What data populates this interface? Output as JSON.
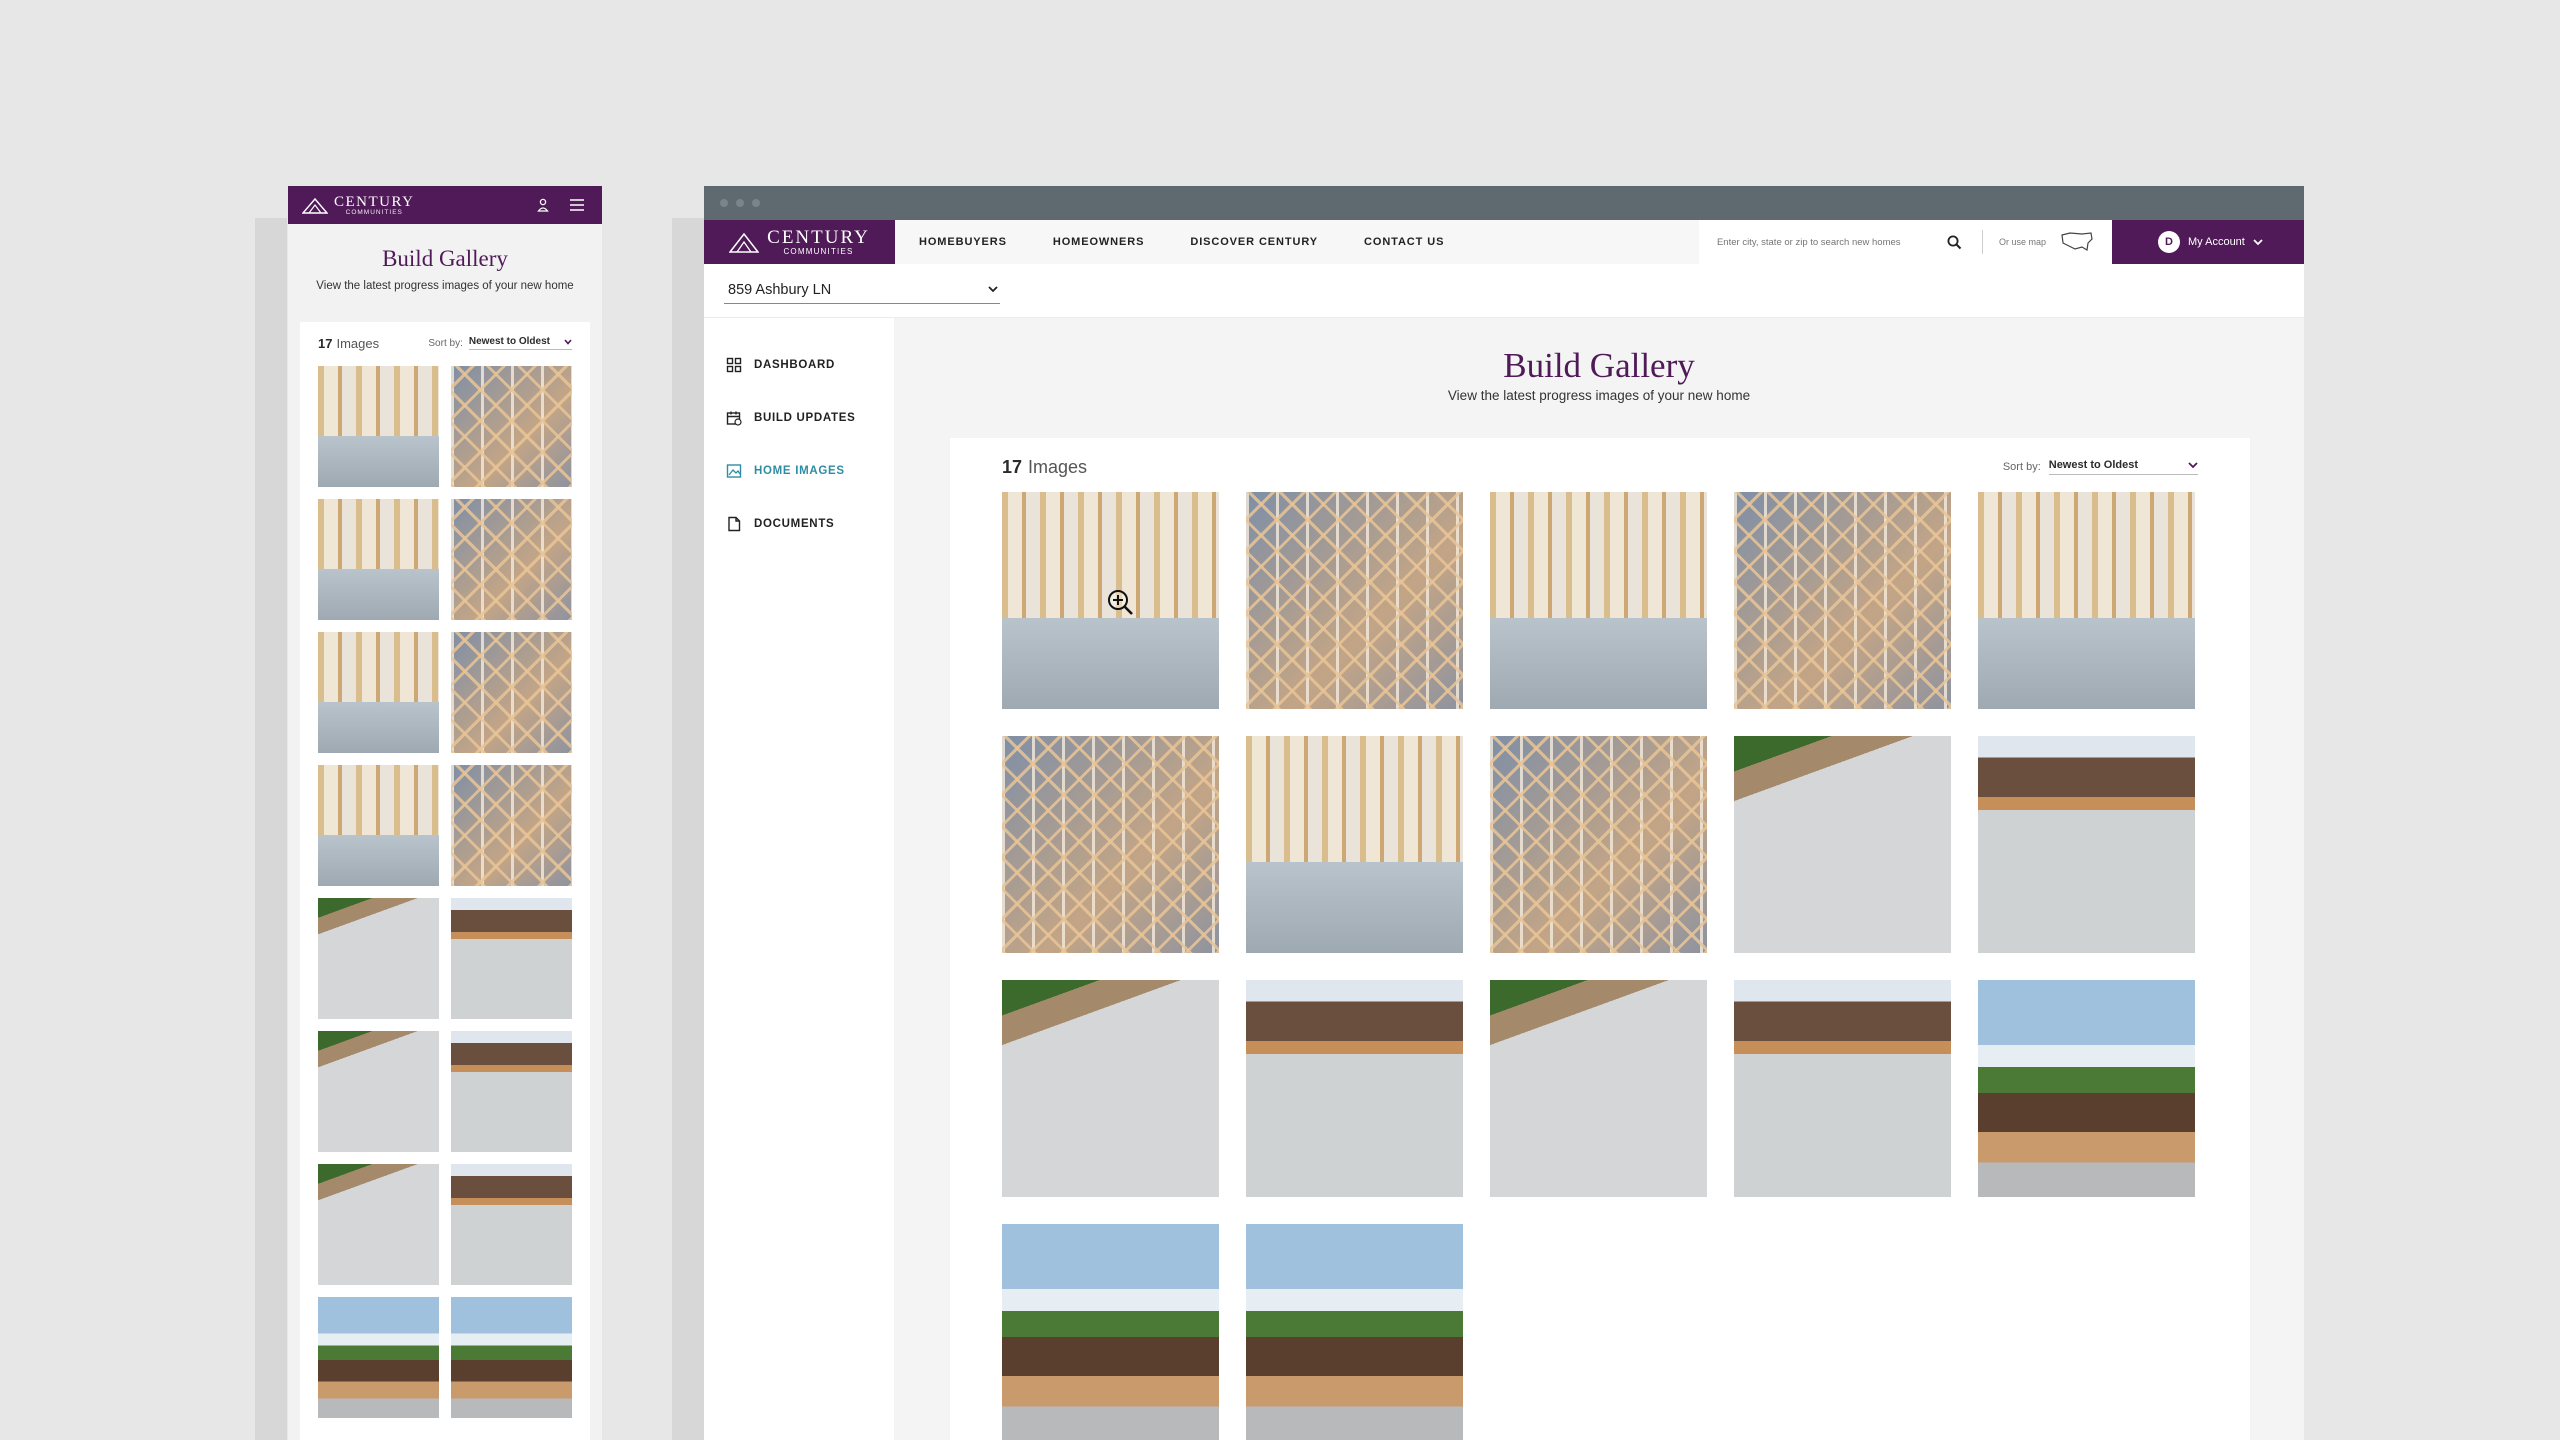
{
  "brand": {
    "name": "CENTURY",
    "tagline": "COMMUNITIES",
    "color": "#4f1a57",
    "accent": "#2f8da3"
  },
  "mobile": {
    "title": "Build Gallery",
    "subtitle": "View the latest progress images of your new home",
    "count": "17",
    "count_label": "Images",
    "sort_label": "Sort by:",
    "sort_value": "Newest to Oldest",
    "thumbs": [
      "framing",
      "truss",
      "framing",
      "truss",
      "framing",
      "truss",
      "framing",
      "truss",
      "slab",
      "house",
      "slab",
      "house",
      "slab",
      "house",
      "field",
      "field"
    ]
  },
  "desktop": {
    "nav": {
      "links": [
        "HOMEBUYERS",
        "HOMEOWNERS",
        "DISCOVER CENTURY",
        "CONTACT US"
      ],
      "search_placeholder": "Enter city, state or zip to search new homes",
      "map_label": "Or use map",
      "account_initial": "D",
      "account_label": "My Account"
    },
    "address": "859 Ashbury LN",
    "sidebar": [
      {
        "label": "DASHBOARD",
        "icon": "dashboard-icon",
        "active": false
      },
      {
        "label": "BUILD UPDATES",
        "icon": "calendar-icon",
        "active": false
      },
      {
        "label": "HOME IMAGES",
        "icon": "image-icon",
        "active": true
      },
      {
        "label": "DOCUMENTS",
        "icon": "document-icon",
        "active": false
      }
    ],
    "title": "Build Gallery",
    "subtitle": "View the latest progress images of your new home",
    "count": "17",
    "count_label": "Images",
    "sort_label": "Sort by:",
    "sort_value": "Newest to Oldest",
    "thumbs": [
      "framing",
      "truss",
      "framing",
      "truss",
      "framing",
      "truss",
      "framing",
      "truss",
      "slab",
      "house",
      "slab",
      "house",
      "slab",
      "house",
      "field",
      "field",
      "field"
    ]
  }
}
